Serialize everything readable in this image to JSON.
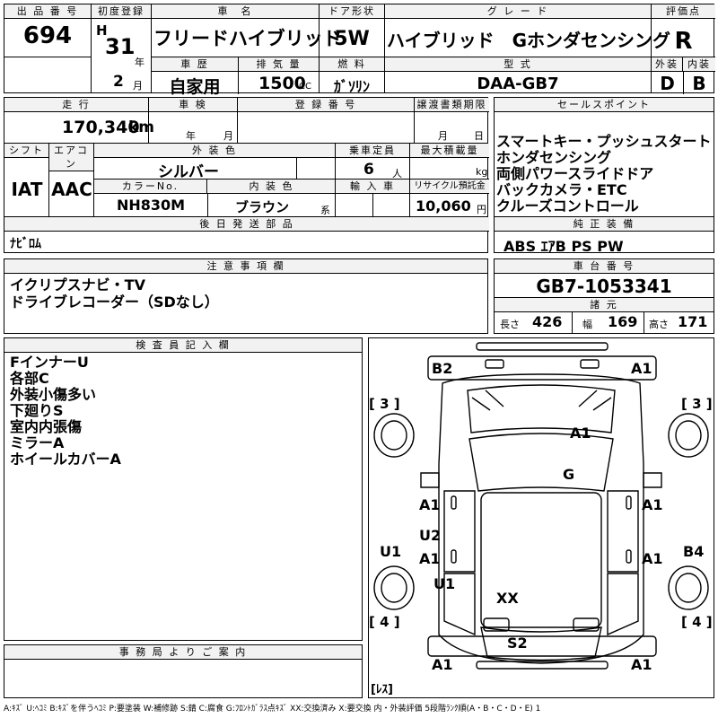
{
  "header": {
    "lot_label": "出 品 番 号",
    "lot_no": "694",
    "first_reg_label": "初度登録",
    "era": "H",
    "year": "31",
    "year_unit": "年",
    "month": "2",
    "month_unit": "月",
    "car_name_label": "車　名",
    "car_name": "フリードハイブリッド",
    "door_label": "ドア形状",
    "door": "5W",
    "grade_label": "グ レ ー ド",
    "grade": "ハイブリッド　Gホンダセンシング",
    "score_label": "評価点",
    "score": "R",
    "history_label": "車 歴",
    "history": "自家用",
    "displacement_label": "排 気 量",
    "displacement": "1500",
    "displacement_unit": "CC",
    "fuel_label": "燃 料",
    "fuel": "ｶﾞｿﾘﾝ",
    "model_label": "型 式",
    "model": "DAA-GB7",
    "ext_label": "外装",
    "ext": "D",
    "int_label": "内装",
    "int": "B"
  },
  "row2": {
    "mileage_label": "走 行",
    "mileage": "170,340",
    "mileage_unit": "km",
    "inspection_label": "車 検",
    "insp_year_unit": "年",
    "insp_month_unit": "月",
    "reg_no_label": "登 録 番 号",
    "transfer_label": "譲渡書類期限",
    "transfer_month_unit": "月",
    "transfer_day_unit": "日",
    "shift_label": "シフト",
    "shift": "IAT",
    "ac_label": "エアコン",
    "ac": "AAC",
    "color_label": "外 装 色",
    "color": "シルバー",
    "capacity_label": "乗車定員",
    "capacity": "6",
    "capacity_unit": "人",
    "load_label": "最大積載量",
    "load_unit": "kg",
    "color_no_label": "カラーNo.",
    "color_no": "NH830M",
    "interior_color_label": "内 装 色",
    "interior_color": "ブラウン",
    "interior_color_unit": "系",
    "import_label": "輸 入 車",
    "recycle_label": "リサイクル預託金",
    "recycle": "10,060",
    "recycle_unit": "円",
    "later_parts_label": "後 日 発 送 部 品",
    "later_parts": "ﾅﾋﾞﾛﾑ"
  },
  "sales": {
    "label": "セールスポイント",
    "points": [
      "スマートキー・プッシュスタート",
      "ホンダセンシング",
      "両側パワースライドドア",
      "バックカメラ・ETC",
      "クルーズコントロール"
    ],
    "equip_label": "純 正 装 備",
    "equip": "ABS ｴｱB PS PW"
  },
  "notes": {
    "label": "注 意 事 項 欄",
    "lines": [
      "イクリプスナビ・TV",
      "ドライブレコーダー（SDなし）"
    ]
  },
  "chassis": {
    "label": "車 台 番 号",
    "number": "GB7-1053341",
    "spec_label": "諸 元",
    "length_label": "長さ",
    "length": "426",
    "width_label": "幅",
    "width": "169",
    "height_label": "高さ",
    "height": "171"
  },
  "inspector": {
    "label": "検 査 員 記 入 欄",
    "lines": [
      "FインナーU",
      "各部C",
      "外装小傷多い",
      "下廻りS",
      "室内内張傷",
      "ミラーA",
      "ホイールカバーA"
    ]
  },
  "office": {
    "label": "事 務 局 よ り ご 案 内"
  },
  "diagram": {
    "marks": [
      "B2",
      "A1",
      "A1",
      "G",
      "A1",
      "A1",
      "U2",
      "A1",
      "A1",
      "U1",
      "U1",
      "B4",
      "XX",
      "S2",
      "A1",
      "A1"
    ],
    "tire_fl": "[ 3 ]",
    "tire_fr": "[ 3 ]",
    "tire_rl": "[ 4 ]",
    "tire_rr": "[ 4 ]",
    "spare": "[ﾚｽ]"
  },
  "legend": "A:ｷｽﾞ U:ﾍｺﾐ B:ｷｽﾞを伴うﾍｺﾐ P:要塗装 W:補修跡 S:錆 C:腐食 G:ﾌﾛﾝﾄｶﾞﾗｽ点ｷｽﾞ XX:交換済み X:要交換 内・外装評価 5段階ﾗﾝｸ順(A・B・C・D・E) 1"
}
